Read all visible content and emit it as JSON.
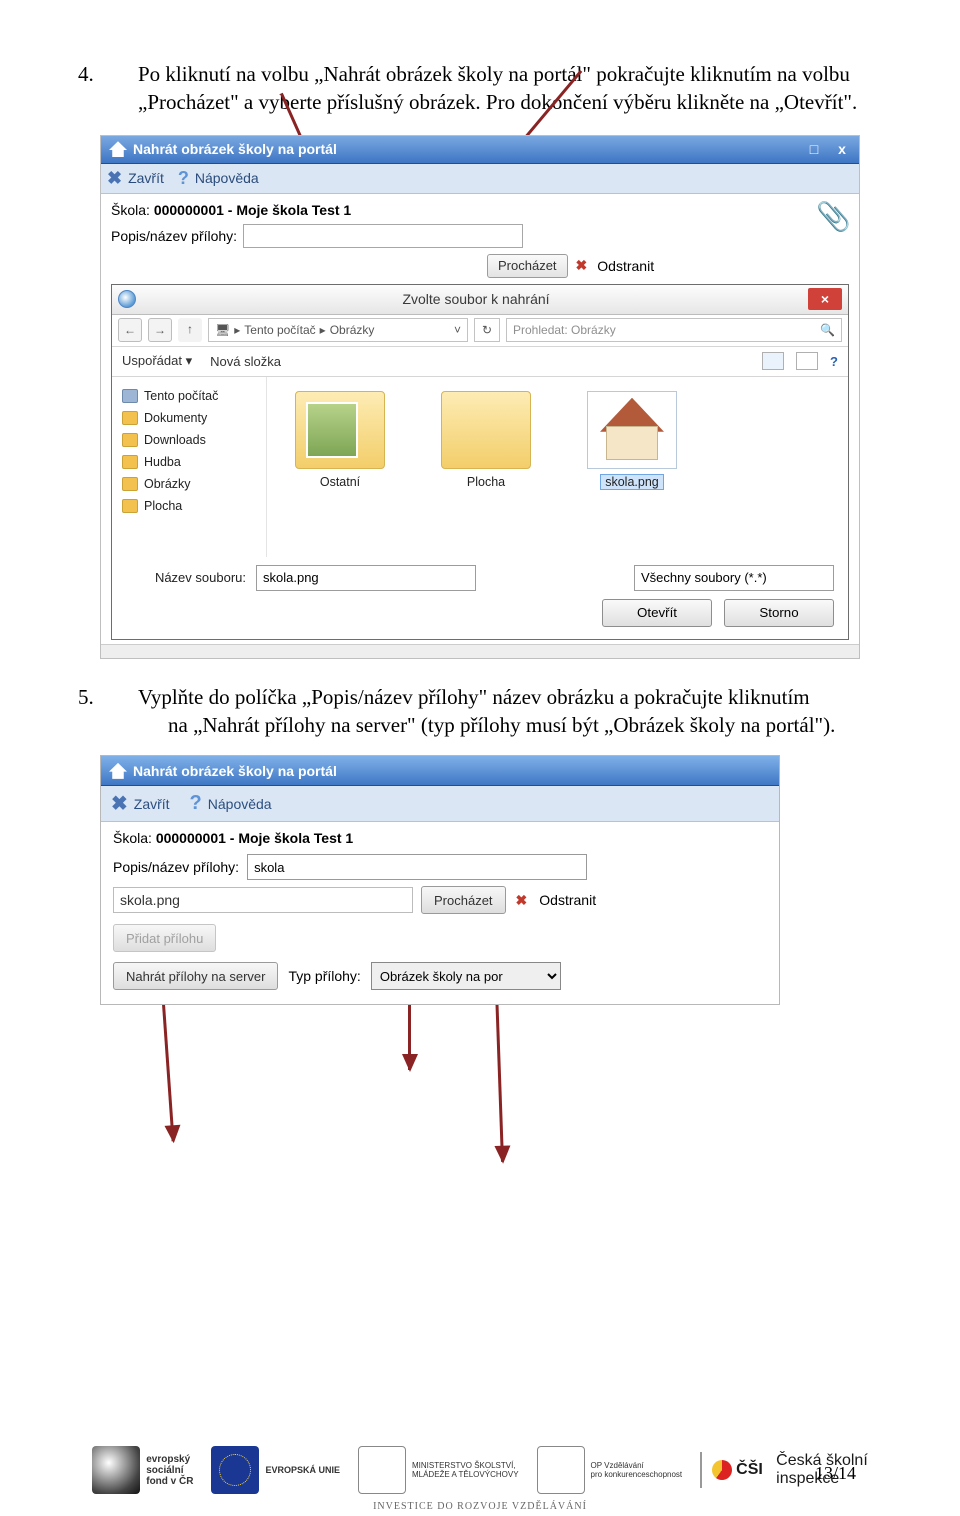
{
  "step4": {
    "num": "4.",
    "text": "Po kliknutí na volbu „Nahrát obrázek školy na portál\" pokračujte kliknutím na volbu „Procházet\" a vyberte příslušný obrázek. Pro dokončení výběru klikněte na „Otevřít\"."
  },
  "step5": {
    "num": "5.",
    "text_a": "Vyplňte do políčka „Popis/název přílohy\" název obrázku a pokračujte kliknutím",
    "text_b": "na „Nahrát přílohy na server\" (typ přílohy musí být „Obrázek školy na portál\")."
  },
  "shot1": {
    "title": "Nahrát obrázek školy na portál",
    "zavrit": "Zavřít",
    "napoveda": "Nápověda",
    "skola_label": "Škola:",
    "skola_value": "000000001 - Moje škola Test 1",
    "popis_label": "Popis/název přílohy:",
    "prochazet": "Procházet",
    "odstranit": "Odstranit",
    "picker": {
      "title": "Zvolte soubor k nahrání",
      "crumb_pc": "Tento počítač",
      "crumb_folder": "Obrázky",
      "search_ph": "Prohledat: Obrázky",
      "usporadat": "Uspořádat ▾",
      "nova_slozka": "Nová složka",
      "tree": [
        "Tento počítač",
        "Dokumenty",
        "Downloads",
        "Hudba",
        "Obrázky",
        "Plocha"
      ],
      "thumbs": [
        "Ostatní",
        "Plocha",
        "skola.png"
      ],
      "file_label": "Název souboru:",
      "file_value": "skola.png",
      "filter_value": "Všechny soubory (*.*)",
      "btn_open": "Otevřít",
      "btn_cancel": "Storno"
    }
  },
  "shot2": {
    "title": "Nahrát obrázek školy na portál",
    "zavrit": "Zavřít",
    "napoveda": "Nápověda",
    "skola_label": "Škola:",
    "skola_value": "000000001 - Moje škola Test 1",
    "popis_label": "Popis/název přílohy:",
    "popis_value": "skola",
    "filename": "skola.png",
    "prochazet": "Procházet",
    "odstranit": "Odstranit",
    "add": "Přidat přílohu",
    "upload": "Nahrát přílohy na server",
    "type_label": "Typ přílohy:",
    "type_value": "Obrázek školy na por"
  },
  "footer": {
    "esf": "evropský\nsociální\nfond v ČR",
    "eu": "EVROPSKÁ UNIE",
    "ms": "MINISTERSTVO ŠKOLSTVÍ,\nMLÁDEŽE A TĚLOVÝCHOVY",
    "op": "OP Vzdělávání\npro konkurenceschopnost",
    "csi_big": "ČŠI",
    "csi1": "Česká školní",
    "csi2": "inspekce",
    "invest": "INVESTICE DO ROZVOJE VZDĚLÁVÁNÍ"
  },
  "pagenum": "13/14"
}
